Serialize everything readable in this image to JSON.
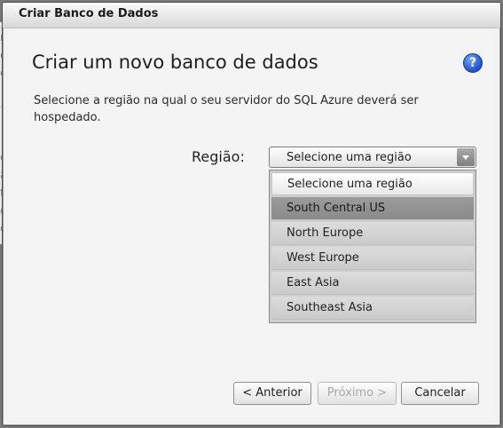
{
  "dialog": {
    "title": "Criar Banco de Dados",
    "heading": "Criar um novo banco de dados",
    "description": "Selecione a região na qual o seu servidor do SQL Azure deverá ser hospedado.",
    "help_icon": "question-circle-icon"
  },
  "region": {
    "label": "Região:",
    "selected": "Selecione uma região",
    "options": [
      "Selecione uma região",
      "South Central US",
      "North Europe",
      "West Europe",
      "East Asia",
      "Southeast Asia"
    ],
    "highlighted_option": "South Central US"
  },
  "buttons": {
    "back": "< Anterior",
    "next": "Próximo >",
    "cancel": "Cancelar"
  },
  "background_fragments": [
    "ne",
    "e",
    "e",
    "ca",
    "ão",
    "fe",
    "de",
    "q"
  ],
  "colors": {
    "help_icon": "#1f52c9",
    "highlight_option": "#8f8f8f"
  }
}
